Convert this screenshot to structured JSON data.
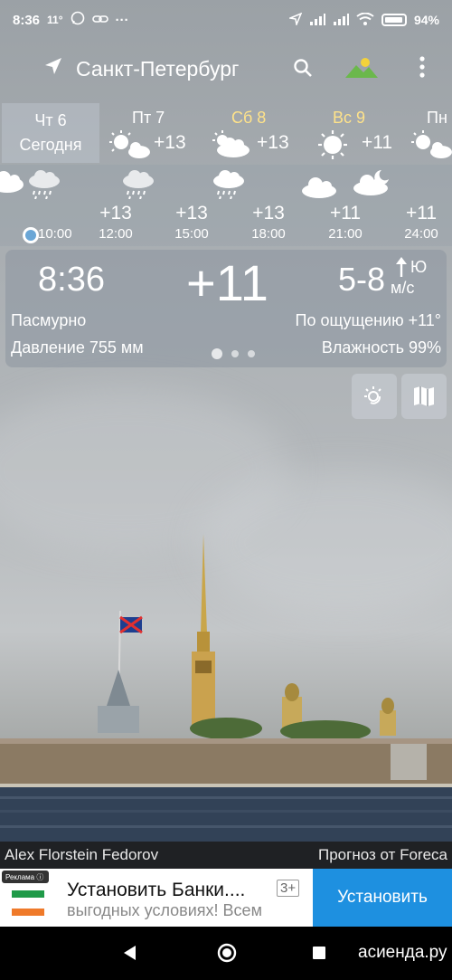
{
  "status_bar": {
    "time": "8:36",
    "temp": "11°",
    "more": "···",
    "battery": "94%"
  },
  "header": {
    "city": "Санкт-Петербург"
  },
  "today": {
    "day": "Чт 6",
    "label": "Сегодня"
  },
  "days": [
    {
      "name": "Пт 7",
      "temp": "+13",
      "weekend": false,
      "icon": "sun-cloud-icon"
    },
    {
      "name": "Сб 8",
      "temp": "+13",
      "weekend": true,
      "icon": "cloud-sun-icon"
    },
    {
      "name": "Вс 9",
      "temp": "+11",
      "weekend": true,
      "icon": "sun-icon"
    },
    {
      "name": "Пн",
      "temp": "",
      "weekend": false,
      "icon": "sun-cloud-icon"
    }
  ],
  "hours": [
    {
      "time": "10:00",
      "temp": "",
      "icon": "cloud-icon"
    },
    {
      "time": "12:00",
      "temp": "+13",
      "icon": "rain-icon"
    },
    {
      "time": "15:00",
      "temp": "+13",
      "icon": "rain-icon"
    },
    {
      "time": "18:00",
      "temp": "+13",
      "icon": "rain-icon"
    },
    {
      "time": "21:00",
      "temp": "+11",
      "icon": "cloud-icon"
    },
    {
      "time": "24:00",
      "temp": "+11",
      "icon": "moon-cloud-icon"
    }
  ],
  "current": {
    "time": "8:36",
    "temp": "+11",
    "wind": "5-8",
    "wind_dir": "Ю",
    "wind_unit": "м/с",
    "condition": "Пасмурно",
    "feels_like": "По ощущению +11°",
    "pressure": "Давление 755 мм",
    "humidity": "Влажность 99%"
  },
  "credits": {
    "photo_author": "Alex Florstein Fedorov",
    "forecast_source": "Прогноз от Foreca"
  },
  "ad": {
    "label": "Реклама",
    "title": "Установить Банки....",
    "subtitle": "выгодных условиях! Всем",
    "age": "3+",
    "button": "Установить"
  },
  "watermark": "асиенда.ру"
}
